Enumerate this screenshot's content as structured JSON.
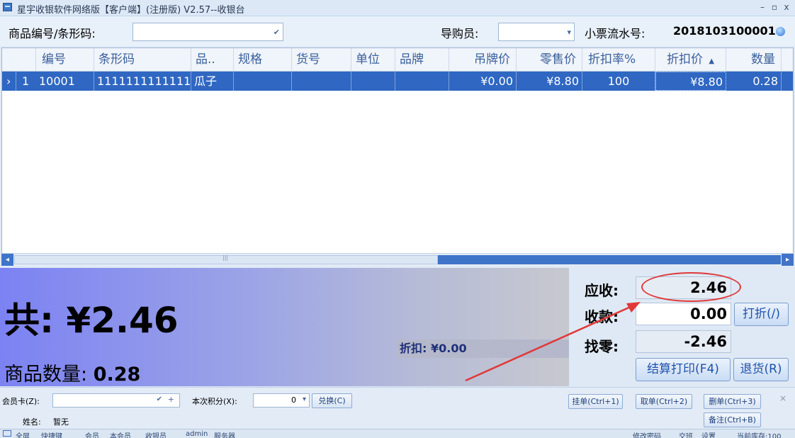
{
  "window": {
    "title": "星宇收银软件网络版【客户端】(注册版) V2.57--收银台",
    "min": "–",
    "max": "▫",
    "close": "x"
  },
  "search": {
    "product_label": "商品编号/条形码:",
    "product_value": "",
    "guide_label": "导购员:",
    "guide_value": "",
    "receipt_label": "小票流水号:",
    "receipt_value": "2018103100001"
  },
  "grid": {
    "columns": [
      "编号",
      "条形码",
      "品..",
      "规格",
      "货号",
      "单位",
      "品牌",
      "吊牌价",
      "零售价",
      "折扣率%",
      "折扣价",
      "数量"
    ],
    "rows": [
      {
        "indicator": "›",
        "num": "1",
        "code": "10001",
        "barcode": "1111111111111",
        "name": "瓜子",
        "spec": "",
        "sku": "",
        "unit": "",
        "brand": "",
        "tag_price": "¥0.00",
        "retail_price": "¥8.80",
        "discount_rate": "100",
        "discount_price": "¥8.80",
        "qty": "0.28"
      }
    ],
    "sort_indicator": "▲"
  },
  "scroll": {
    "left": "◂",
    "right": "▸",
    "grip": "|||"
  },
  "summary": {
    "total": "共: ¥2.46",
    "qty_label": "商品数量:",
    "qty_value": "0.28",
    "discount": "折扣: ¥0.00"
  },
  "pay": {
    "due_label": "应收:",
    "due_value": "2.46",
    "received_label": "收款:",
    "received_value": "0.00",
    "change_label": "找零:",
    "change_value": "-2.46",
    "discount_btn": "打折(/)",
    "checkout_btn": "结算打印(F4)",
    "refund_btn": "退货(R)"
  },
  "bottom": {
    "member_label": "会员卡(Z):",
    "member_value": "",
    "points_label": "本次积分(X):",
    "points_value": "0",
    "redeem_btn": "兑换(C)",
    "name_label": "姓名:",
    "name_value": "暂无",
    "hold_btn": "挂单(Ctrl+1)",
    "retrieve_btn": "取单(Ctrl+2)",
    "delete_btn": "删单(Ctrl+3)",
    "note_btn": "备注(Ctrl+B)",
    "close": "×"
  },
  "statusbar": {
    "items": [
      "全屏",
      "快捷键",
      "会员",
      "本会员",
      "收银员",
      "admin",
      "服务器",
      "修改密码",
      "交班",
      "设置",
      "当前库存:100"
    ]
  },
  "colors": {
    "row_selected": "#2f67c2",
    "annotation": "#e03838",
    "accent": "#1f52a8"
  }
}
